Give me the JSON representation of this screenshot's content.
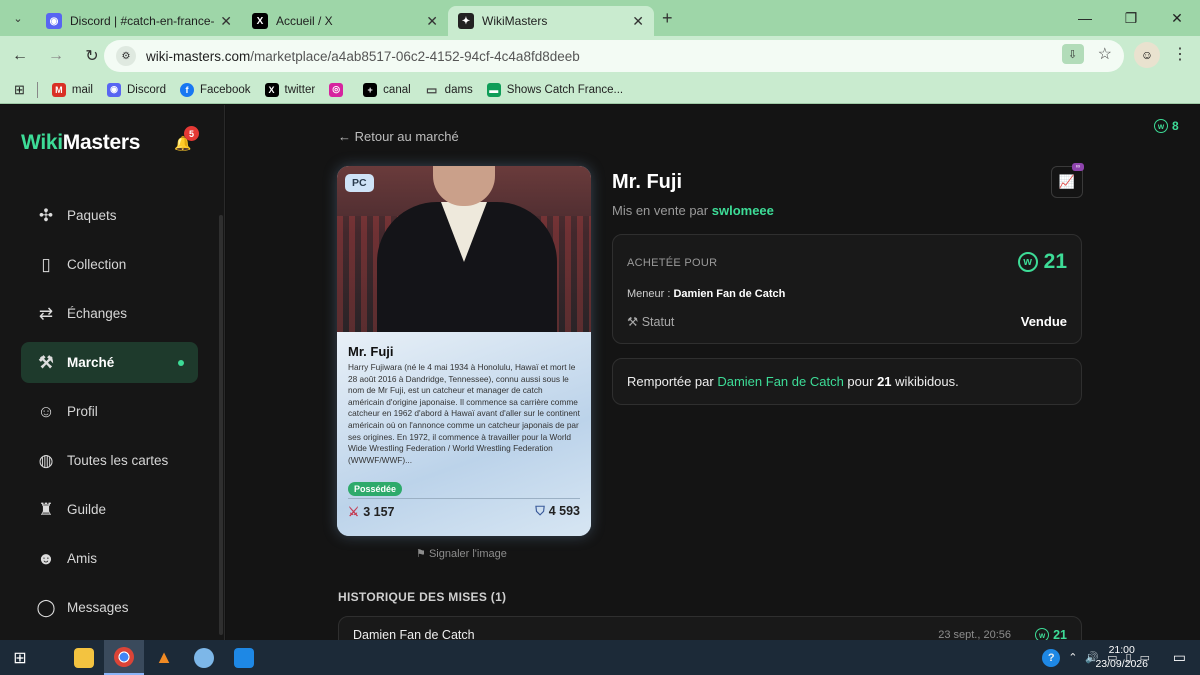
{
  "browser": {
    "tabs": [
      {
        "title": "Discord | #catch-en-france-gene",
        "favicon": "discord-icon",
        "color": "#5865F2"
      },
      {
        "title": "Accueil / X",
        "favicon": "x-icon",
        "color": "#000000"
      },
      {
        "title": "WikiMasters",
        "favicon": "wikimasters-icon",
        "color": "#222222"
      }
    ],
    "url_domain": "wiki-masters.com",
    "url_path": "/marketplace/a4ab8517-06c2-4152-94cf-4c4a8fd8deeb",
    "bookmarks": [
      {
        "label": "mail",
        "icon": "gmail-icon",
        "color": "#d93025"
      },
      {
        "label": "Discord",
        "icon": "discord-icon",
        "color": "#5865F2"
      },
      {
        "label": "Facebook",
        "icon": "facebook-icon",
        "color": "#1877F2"
      },
      {
        "label": "twitter",
        "icon": "x-icon",
        "color": "#000000"
      },
      {
        "label": "",
        "icon": "instagram-icon",
        "color": "#d6249f"
      },
      {
        "label": "canal",
        "icon": "canal-icon",
        "color": "#000000"
      },
      {
        "label": "dams",
        "icon": "folder-icon",
        "color": "#444444"
      },
      {
        "label": "Shows Catch France...",
        "icon": "shows-icon",
        "color": "#0f9d58"
      }
    ]
  },
  "app": {
    "logo_part1": "Wiki",
    "logo_part2": "Masters",
    "notification_count": "5",
    "coins": "8",
    "nav": [
      {
        "label": "Paquets",
        "icon": "puzzle-icon",
        "glyph": "✣"
      },
      {
        "label": "Collection",
        "icon": "book-icon",
        "glyph": "📖"
      },
      {
        "label": "Échanges",
        "icon": "handshake-icon",
        "glyph": "⇄"
      },
      {
        "label": "Marché",
        "icon": "gavel-icon",
        "glyph": "⚒",
        "active": true
      },
      {
        "label": "Profil",
        "icon": "user-icon",
        "glyph": "👤"
      },
      {
        "label": "Toutes les cartes",
        "icon": "globe-icon",
        "glyph": "🌐"
      },
      {
        "label": "Guilde",
        "icon": "castle-icon",
        "glyph": "♜"
      },
      {
        "label": "Amis",
        "icon": "friends-icon",
        "glyph": "👥"
      },
      {
        "label": "Messages",
        "icon": "chat-icon",
        "glyph": "💬"
      }
    ]
  },
  "page": {
    "back_label": "Retour au marché",
    "card": {
      "badge": "PC",
      "name": "Mr. Fuji",
      "description": "Harry Fujiwara (né le 4 mai 1934 à Honolulu, Hawaï et mort le 28 août 2016 à Dandridge, Tennessee), connu aussi sous le nom de Mr Fuji, est un catcheur et manager de catch américain d'origine japonaise. Il commence sa carrière comme catcheur en 1962 d'abord à Hawaï avant d'aller sur le continent américain où on l'annonce comme un catcheur japonais de par ses origines. En 1972, il commence à travailler pour la World Wide Wrestling Federation / World Wrestling Federation (WWWF/WWF)...",
      "owned_label": "Possédée",
      "attack": "3 157",
      "defense": "4 593"
    },
    "report_label": "Signaler l'image",
    "title": "Mr. Fuji",
    "seller_prefix": "Mis en vente par",
    "seller": "swlomeee",
    "bought_label": "ACHETÉE POUR",
    "price": "21",
    "meneur_label": "Meneur :",
    "meneur": "Damien Fan de Catch",
    "statut_label": "Statut",
    "statut": "Vendue",
    "won_prefix": "Remportée par",
    "won_by": "Damien Fan de Catch",
    "won_mid": "pour",
    "won_amount": "21",
    "won_suffix": "wikibidous.",
    "history_title": "HISTORIQUE DES MISES (1)",
    "history": [
      {
        "name": "Damien Fan de Catch",
        "date": "23 sept., 20:56",
        "amount": "21"
      }
    ]
  },
  "taskbar": {
    "time": "21:00",
    "date": "23/09/2026"
  }
}
